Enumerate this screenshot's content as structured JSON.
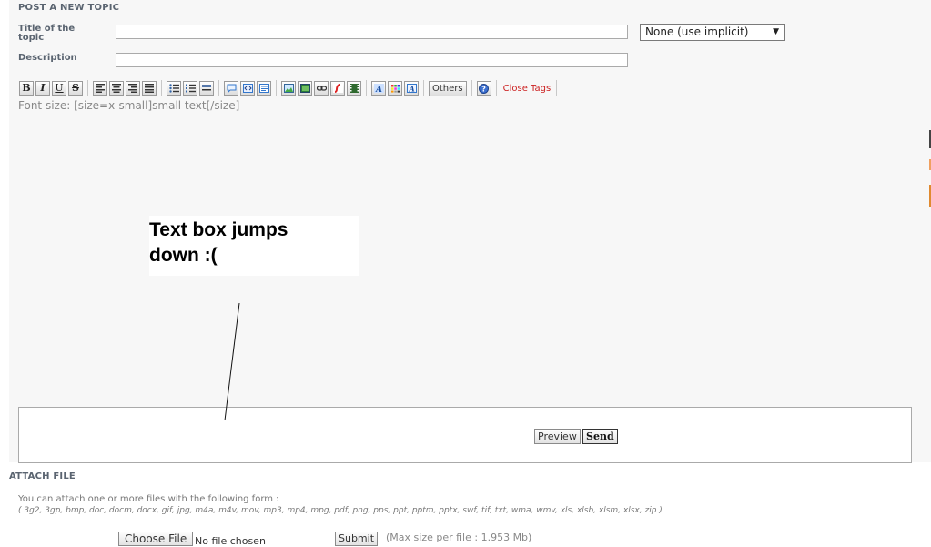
{
  "form": {
    "heading": "POST A NEW TOPIC",
    "title_label": "Title of the topic",
    "title_value": "",
    "description_label": "Description",
    "description_value": "",
    "icon_select": "None (use implicit)"
  },
  "toolbar": {
    "buttons": [
      "B",
      "I",
      "U",
      "S"
    ],
    "others_label": "Others",
    "close_tags_label": "Close Tags",
    "icons": [
      "bold-icon",
      "italic-icon",
      "underline-icon",
      "strikethrough-icon",
      "align-left-icon",
      "align-center-icon",
      "align-right-icon",
      "align-justify-icon",
      "bullet-list-icon",
      "numbered-list-icon",
      "horizontal-rule-icon",
      "quote-icon",
      "code-icon",
      "spoiler-icon",
      "image-icon",
      "picture-icon",
      "link-icon",
      "flash-icon",
      "video-icon",
      "font-icon",
      "color-icon",
      "size-icon",
      "help-icon"
    ]
  },
  "editor": {
    "hint": "Font size: [size=x-small]small text[/size]",
    "preview_label": "Preview",
    "send_label": "Send"
  },
  "annotation": {
    "text_line1": "Text box jumps",
    "text_line2": "down :("
  },
  "attach": {
    "heading": "ATTACH FILE",
    "description": "You can attach one or more files with the following form :",
    "types": "( 3g2, 3gp, bmp, doc, docm, docx, gif, jpg, m4a, m4v, mov, mp3, mp4, mpg, pdf, png, pps, ppt, pptm, pptx, swf, tif, txt, wma, wmv, xls, xlsb, xlsm, xlsx, zip )",
    "choose_file_label": "Choose File",
    "file_status": "No file chosen",
    "submit_label": "Submit",
    "max_size": "(Max size per file : 1.953 Mb)"
  },
  "colors": {
    "panel_bg": "#f7f7f7",
    "label": "#5a6470",
    "close_tags": "#cc2222"
  }
}
